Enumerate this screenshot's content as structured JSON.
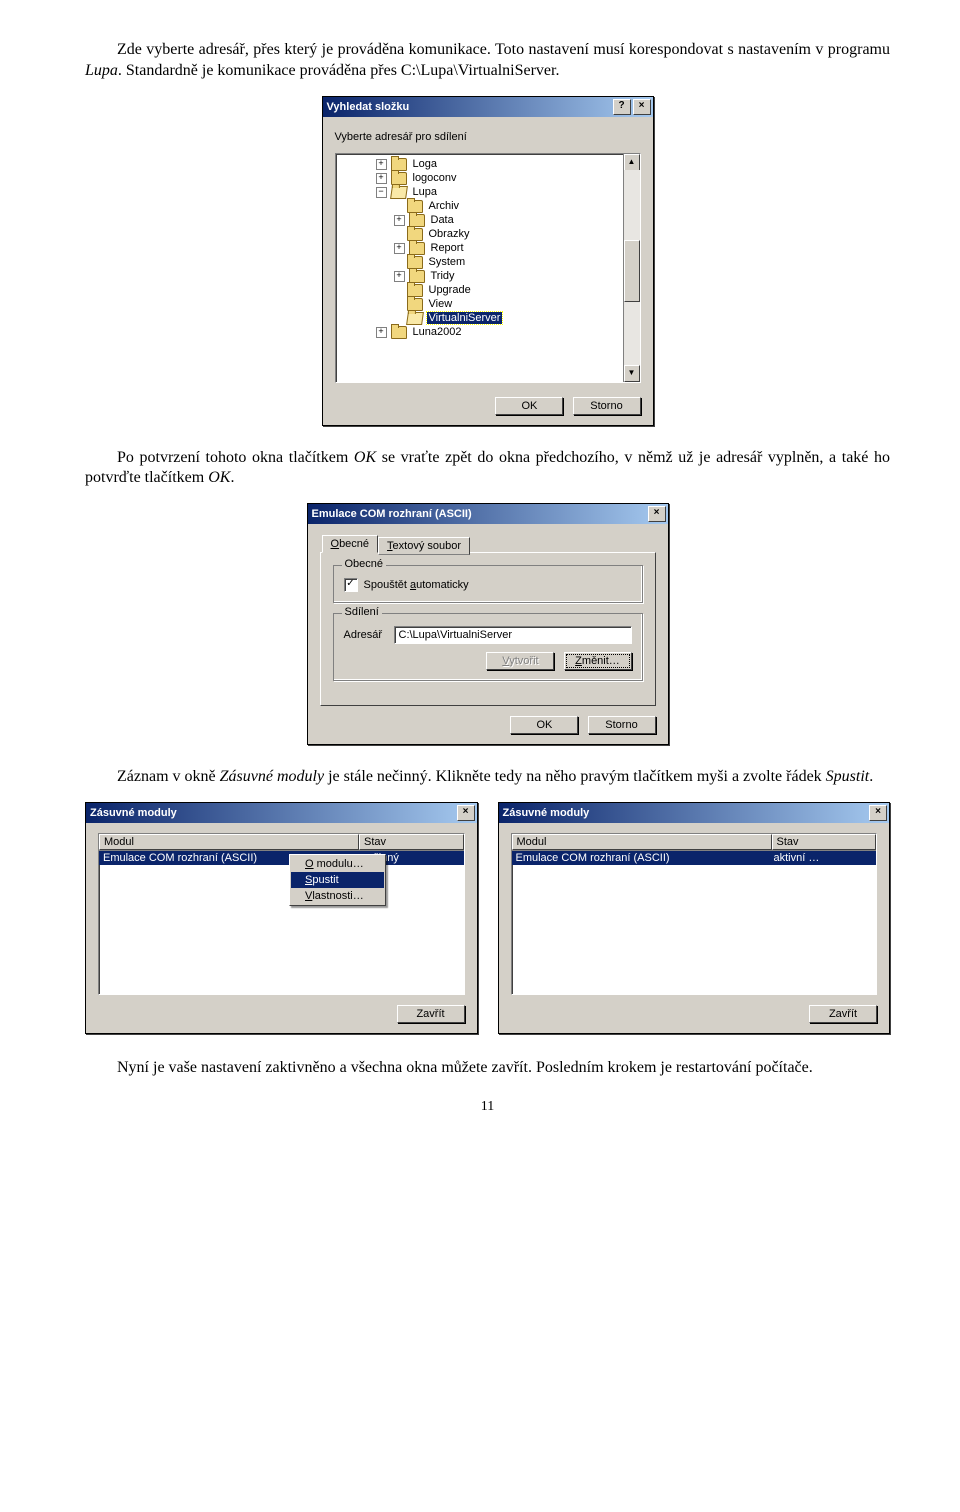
{
  "para1_pre": "Zde vyberte adresář, přes který je prováděna komunikace. Toto nastavení musí korespondovat s nastavením v programu ",
  "para1_prog": "Lupa",
  "para1_post": ". Standardně je komunikace prováděna přes C:\\Lupa\\VirtualniServer.",
  "para2_pre": "Po potvrzení tohoto okna tlačítkem ",
  "para2_ok": "OK",
  "para2_mid": " se vraťte zpět do okna předchozího, v němž už je adresář vyplněn, a také ho potvrďte tlačítkem ",
  "para2_ok2": "OK",
  "para2_post": ".",
  "para3_pre": "Záznam v okně ",
  "para3_win": "Zásuvné moduly",
  "para3_mid": " je stále nečinný. Klikněte tedy na něho pravým tlačítkem myši a zvolte řádek ",
  "para3_cmd": "Spustit",
  "para3_post": ".",
  "para4": "Nyní je vaše nastavení zaktivněno a všechna okna můžete zavřít. Posledním krokem je restartování počítače.",
  "page_number": "11",
  "d1": {
    "title": "Vyhledat složku",
    "help_btn": "?",
    "close_btn": "×",
    "instruction": "Vyberte adresář pro sdílení",
    "tree": [
      {
        "level": 1,
        "exp": "+",
        "icon": "closed",
        "label": "Loga"
      },
      {
        "level": 1,
        "exp": "+",
        "icon": "closed",
        "label": "logoconv"
      },
      {
        "level": 1,
        "exp": "−",
        "icon": "open",
        "label": "Lupa"
      },
      {
        "level": 2,
        "exp": "",
        "icon": "closed",
        "label": "Archiv"
      },
      {
        "level": 2,
        "exp": "+",
        "icon": "closed",
        "label": "Data"
      },
      {
        "level": 2,
        "exp": "",
        "icon": "closed",
        "label": "Obrazky"
      },
      {
        "level": 2,
        "exp": "+",
        "icon": "closed",
        "label": "Report"
      },
      {
        "level": 2,
        "exp": "",
        "icon": "closed",
        "label": "System"
      },
      {
        "level": 2,
        "exp": "+",
        "icon": "closed",
        "label": "Tridy"
      },
      {
        "level": 2,
        "exp": "",
        "icon": "closed",
        "label": "Upgrade"
      },
      {
        "level": 2,
        "exp": "",
        "icon": "closed",
        "label": "View"
      },
      {
        "level": 2,
        "exp": "",
        "icon": "open",
        "label": "VirtualniServer",
        "selected": true
      },
      {
        "level": 1,
        "exp": "+",
        "icon": "closed",
        "label": "Luna2002"
      }
    ],
    "ok_label": "OK",
    "cancel_label": "Storno"
  },
  "d2": {
    "title": "Emulace COM rozhraní (ASCII)",
    "close_btn": "×",
    "tab1_prefix": "O",
    "tab1_rest": "becné",
    "tab2_prefix": "T",
    "tab2_rest": "extový soubor",
    "group1": "Obecné",
    "chk_prefix": "Spouštět ",
    "chk_accel": "a",
    "chk_rest": "utomaticky",
    "chk_checked": "✓",
    "group2": "Sdílení",
    "addr_label": "Adresář",
    "addr_value": "C:\\Lupa\\VirtualniServer",
    "create_accel": "V",
    "create_rest": "ytvořit",
    "change_accel": "Z",
    "change_rest": "měnit…",
    "ok_label": "OK",
    "cancel_label": "Storno"
  },
  "plugins_title": "Zásuvné moduly",
  "plugins_close": "×",
  "col_module": "Modul",
  "col_state": "Stav",
  "module_name": "Emulace COM rozhraní (ASCII)",
  "state_inactive": "nečinný",
  "state_active": "aktivní …",
  "ctx": {
    "about_accel": "O",
    "about_rest": " modulu…",
    "run_accel": "S",
    "run_rest": "pustit",
    "props_accel": "V",
    "props_rest": "lastnosti…"
  },
  "close_label": "Zavřít"
}
